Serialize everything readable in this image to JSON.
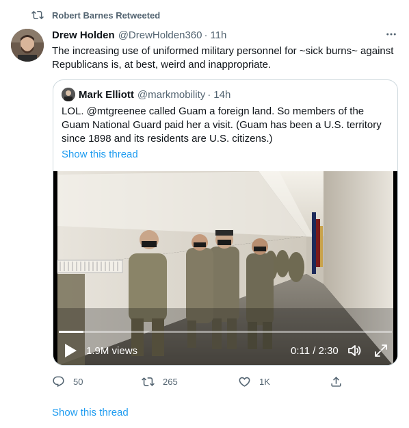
{
  "retweet_banner": {
    "icon": "retweet-icon",
    "text": "Robert Barnes Retweeted"
  },
  "tweet": {
    "author_name": "Drew Holden",
    "author_handle": "@DrewHolden360",
    "separator": "·",
    "time": "11h",
    "text": "The increasing use of uniformed military personnel for ~sick burns~ against Republicans is, at best, weird and inappropriate.",
    "more_icon": "more-horizontal-icon"
  },
  "quote": {
    "author_name": "Mark Elliott",
    "author_handle": "@markmobility",
    "separator": "·",
    "time": "14h",
    "text": "LOL. @mtgreenee called Guam a foreign land. So members of the Guam National Guard paid her a visit. (Guam has been a U.S. territory since 1898 and its residents are U.S. citizens.)",
    "show_thread": "Show this thread",
    "video": {
      "views": "1.9M views",
      "timecode": "0:11 / 2:30",
      "progress": 0.073,
      "play_icon": "play-icon",
      "volume_icon": "volume-icon",
      "fullscreen_icon": "fullscreen-icon"
    }
  },
  "actions": {
    "reply": {
      "icon": "reply-icon",
      "count": "50"
    },
    "retweet": {
      "icon": "retweet-icon",
      "count": "265"
    },
    "like": {
      "icon": "heart-icon",
      "count": "1K"
    },
    "share": {
      "icon": "share-icon"
    }
  },
  "show_thread": "Show this thread",
  "colors": {
    "link": "#1d9bf0",
    "secondary": "#536471",
    "border": "#cfd9de"
  }
}
